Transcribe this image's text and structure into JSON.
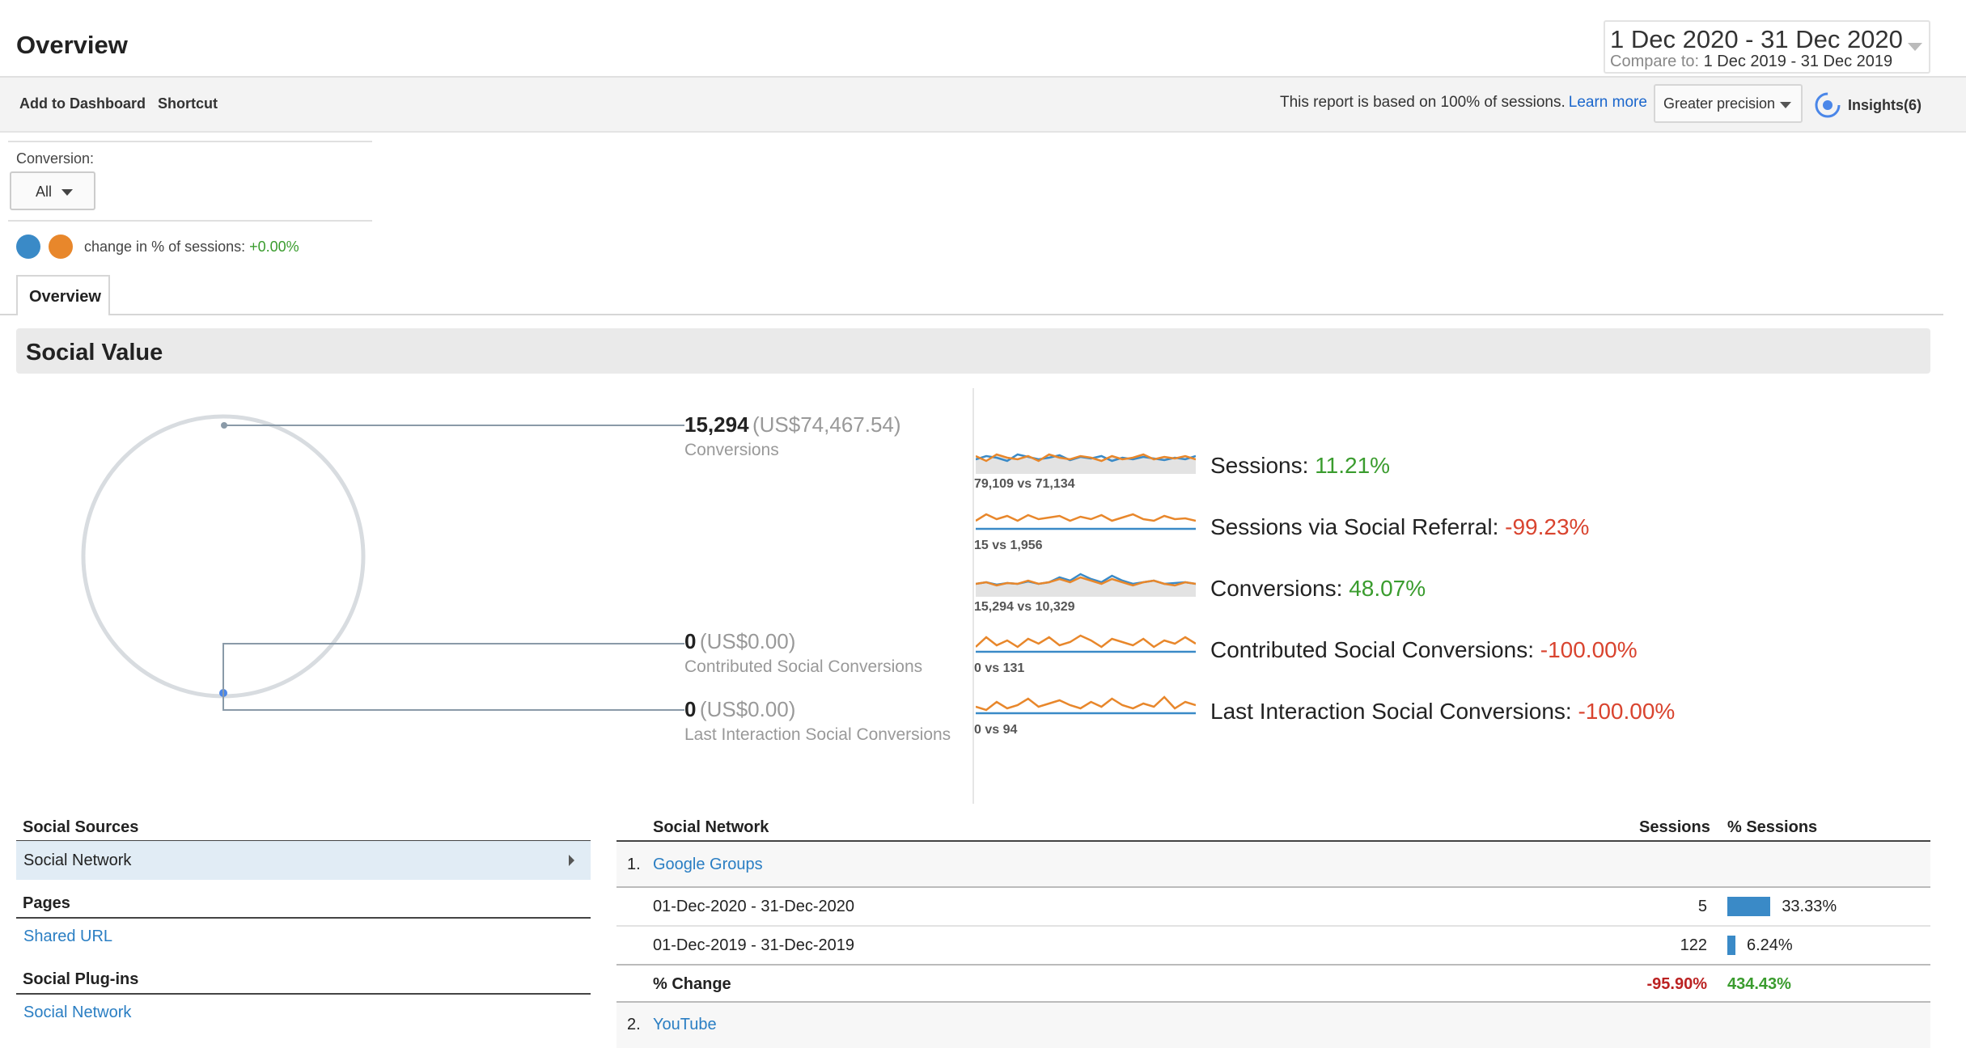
{
  "header": {
    "title": "Overview",
    "date_range": "1 Dec 2020 - 31 Dec 2020",
    "compare_label": "Compare to:",
    "compare_range": "1 Dec 2019 - 31 Dec 2019"
  },
  "toolbar": {
    "add_dashboard": "Add to Dashboard",
    "shortcut": "Shortcut",
    "sample_note": "This report is based on 100% of sessions.",
    "learn_more": "Learn more",
    "precision": "Greater precision",
    "insights": "Insights(6)"
  },
  "conversion": {
    "label": "Conversion:",
    "selected": "All"
  },
  "segments": {
    "text": "change in % of sessions: ",
    "value": "+0.00%",
    "colors": {
      "current": "#3a8ac7",
      "previous": "#e8872b"
    }
  },
  "tabs": [
    {
      "label": "Overview"
    }
  ],
  "social_value": {
    "title": "Social Value",
    "conversions": {
      "count": "15,294",
      "money": "(US$74,467.54)",
      "label": "Conversions"
    },
    "contributed": {
      "count": "0",
      "money": "(US$0.00)",
      "label": "Contributed Social Conversions"
    },
    "last_interaction": {
      "count": "0",
      "money": "(US$0.00)",
      "label": "Last Interaction Social Conversions"
    }
  },
  "sparklines": [
    {
      "caption": "79,109 vs 71,134",
      "label": "Sessions:",
      "change": "11.21%",
      "positive": true
    },
    {
      "caption": "15 vs 1,956",
      "label": "Sessions via Social Referral:",
      "change": "-99.23%",
      "positive": false
    },
    {
      "caption": "15,294 vs 10,329",
      "label": "Conversions:",
      "change": "48.07%",
      "positive": true
    },
    {
      "caption": "0 vs 131",
      "label": "Contributed Social Conversions:",
      "change": "-100.00%",
      "positive": false
    },
    {
      "caption": "0 vs 94",
      "label": "Last Interaction Social Conversions:",
      "change": "-100.00%",
      "positive": false
    }
  ],
  "social_sources": {
    "heading": "Social Sources",
    "selected": "Social Network",
    "pages_heading": "Pages",
    "shared_url": "Shared URL",
    "plugins_heading": "Social Plug-ins",
    "plugins_network": "Social Network"
  },
  "table": {
    "columns": [
      "Social Network",
      "Sessions",
      "% Sessions"
    ],
    "rows": [
      {
        "index": "1.",
        "name": "Google Groups",
        "sub": [
          {
            "period": "01-Dec-2020 - 31-Dec-2020",
            "sessions": "5",
            "pct": "33.33%",
            "pct_value": 33.33
          },
          {
            "period": "01-Dec-2019 - 31-Dec-2019",
            "sessions": "122",
            "pct": "6.24%",
            "pct_value": 6.24
          }
        ],
        "change_label": "% Change",
        "change_sessions": "-95.90%",
        "change_pct": "434.43%"
      },
      {
        "index": "2.",
        "name": "YouTube"
      }
    ]
  }
}
